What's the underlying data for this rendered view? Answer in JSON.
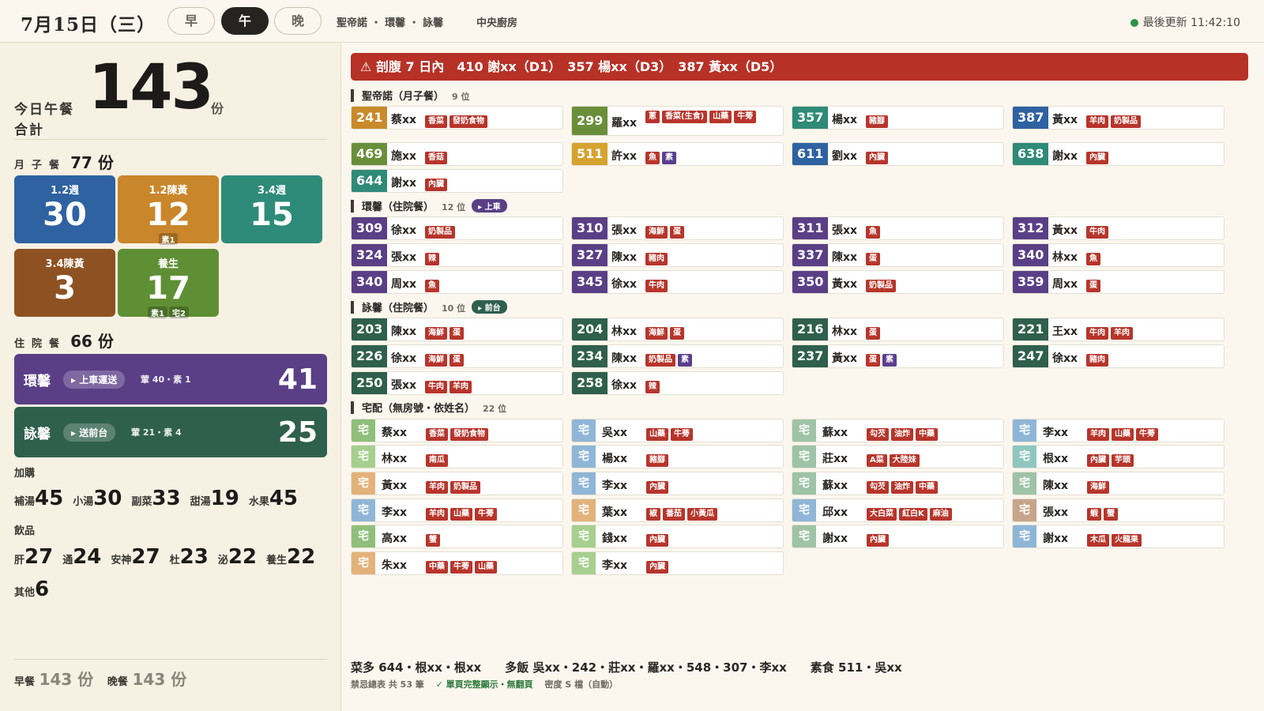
{
  "topbar": {
    "date": "7月15日（三）",
    "meals": [
      "早",
      "午",
      "晚"
    ],
    "active_meal": 1,
    "locations": [
      "聖帝諾",
      "環馨",
      "詠馨"
    ],
    "kitchen": "中央廚房",
    "update_label": "最後更新 11:42:10"
  },
  "sidebar": {
    "today_label": "今日午餐",
    "total_label": "合計",
    "total": "143",
    "unit": "份",
    "yuezi": {
      "label": "月子餐",
      "value": "77 份"
    },
    "tiles": [
      {
        "label": "1.2週",
        "value": "30",
        "badges": [],
        "color": "#2f62a1"
      },
      {
        "label": "1.2陳黃",
        "value": "12",
        "badges": [
          "素1"
        ],
        "color": "#c9862a"
      },
      {
        "label": "3.4週",
        "value": "15",
        "badges": [],
        "color": "#2e8b7a"
      },
      {
        "label": "3.4陳黃",
        "value": "3",
        "badges": [],
        "color": "#8e5222"
      },
      {
        "label": "養生",
        "value": "17",
        "badges": [
          "素1",
          "宅2"
        ],
        "color": "#5f8f34"
      }
    ],
    "hospital": {
      "label": "住院餐",
      "value": "66 份"
    },
    "wards": [
      {
        "name": "環馨",
        "tag": "▸ 上車運送",
        "sub": "葷 40・素 1",
        "value": "41",
        "color": "#5a3f86"
      },
      {
        "name": "詠馨",
        "tag": "▸ 送前台",
        "sub": "葷 21・素 4",
        "value": "25",
        "color": "#2f5f4d"
      }
    ],
    "addon_label": "加購",
    "addons": [
      {
        "k": "補湯",
        "v": "45"
      },
      {
        "k": "小湯",
        "v": "30"
      },
      {
        "k": "副菜",
        "v": "33"
      },
      {
        "k": "甜湯",
        "v": "19"
      },
      {
        "k": "水果",
        "v": "45"
      }
    ],
    "drinks_label": "飲品",
    "drinks": [
      {
        "k": "肝",
        "v": "27"
      },
      {
        "k": "通",
        "v": "24"
      },
      {
        "k": "安神",
        "v": "27"
      },
      {
        "k": "杜",
        "v": "23"
      },
      {
        "k": "泌",
        "v": "22"
      },
      {
        "k": "養生",
        "v": "22"
      }
    ],
    "other": {
      "k": "其他",
      "v": "6"
    },
    "breakfast": {
      "k": "早餐",
      "v": "143 份"
    },
    "dinner": {
      "k": "晚餐",
      "v": "143 份"
    }
  },
  "alert": "⚠ 剖腹 7 日內　410 謝xx（D1）　357 楊xx（D3）　387 黃xx（D5）",
  "groups": [
    {
      "title": "聖帝諾（月子餐）",
      "count": "9 位",
      "tag": "",
      "tag_color": "",
      "rows": [
        [
          {
            "room": "241",
            "name": "蔡xx",
            "tags": [
              "香菜",
              "發奶食物"
            ],
            "color": "#c98a2b"
          },
          {
            "room": "299",
            "name": "羅xx",
            "tags": [
              "蔥",
              "香菜(生食)",
              "山藥",
              "牛蒡"
            ],
            "color": "#6a8f3a"
          },
          {
            "room": "357",
            "name": "楊xx",
            "tags": [
              "豬腳"
            ],
            "color": "#2f8a78"
          },
          {
            "room": "387",
            "name": "黃xx",
            "tags": [
              "羊肉",
              "奶製品"
            ],
            "color": "#2f62a1"
          }
        ],
        [
          {
            "room": "469",
            "name": "施xx",
            "tags": [
              "香菇"
            ],
            "color": "#6a8f3a"
          },
          {
            "room": "511",
            "name": "許xx",
            "tags": [
              "魚",
              "素"
            ],
            "color": "#d6a32e"
          },
          {
            "room": "611",
            "name": "劉xx",
            "tags": [
              "內臟"
            ],
            "color": "#2f62a1"
          },
          {
            "room": "638",
            "name": "謝xx",
            "tags": [
              "內臟"
            ],
            "color": "#2f8a78"
          }
        ],
        [
          {
            "room": "644",
            "name": "謝xx",
            "tags": [
              "內臟"
            ],
            "color": "#2f8a78"
          }
        ]
      ]
    },
    {
      "title": "環馨（住院餐）",
      "count": "12 位",
      "tag": "▸ 上車",
      "tag_color": "#5a3f86",
      "rows": [
        [
          {
            "room": "309",
            "name": "徐xx",
            "tags": [
              "奶製品"
            ],
            "color": "#5a3f86"
          },
          {
            "room": "310",
            "name": "張xx",
            "tags": [
              "海鮮",
              "蛋"
            ],
            "color": "#5a3f86"
          },
          {
            "room": "311",
            "name": "張xx",
            "tags": [
              "魚"
            ],
            "color": "#5a3f86"
          },
          {
            "room": "312",
            "name": "黃xx",
            "tags": [
              "牛肉"
            ],
            "color": "#5a3f86"
          }
        ],
        [
          {
            "room": "324",
            "name": "張xx",
            "tags": [
              "辣"
            ],
            "color": "#5a3f86"
          },
          {
            "room": "327",
            "name": "陳xx",
            "tags": [
              "豬肉"
            ],
            "color": "#5a3f86"
          },
          {
            "room": "337",
            "name": "陳xx",
            "tags": [
              "蛋"
            ],
            "color": "#5a3f86"
          },
          {
            "room": "340",
            "name": "林xx",
            "tags": [
              "魚"
            ],
            "color": "#5a3f86"
          }
        ],
        [
          {
            "room": "340",
            "name": "周xx",
            "tags": [
              "魚"
            ],
            "color": "#5a3f86"
          },
          {
            "room": "345",
            "name": "徐xx",
            "tags": [
              "牛肉"
            ],
            "color": "#5a3f86"
          },
          {
            "room": "350",
            "name": "黃xx",
            "tags": [
              "奶製品"
            ],
            "color": "#5a3f86"
          },
          {
            "room": "359",
            "name": "周xx",
            "tags": [
              "蛋"
            ],
            "color": "#5a3f86"
          }
        ]
      ]
    },
    {
      "title": "詠馨（住院餐）",
      "count": "10 位",
      "tag": "▸ 前台",
      "tag_color": "#2f5f4d",
      "rows": [
        [
          {
            "room": "203",
            "name": "陳xx",
            "tags": [
              "海鮮",
              "蛋"
            ],
            "color": "#2f5f4d"
          },
          {
            "room": "204",
            "name": "林xx",
            "tags": [
              "海鮮",
              "蛋"
            ],
            "color": "#2f5f4d"
          },
          {
            "room": "216",
            "name": "林xx",
            "tags": [
              "蛋"
            ],
            "color": "#2f5f4d"
          },
          {
            "room": "221",
            "name": "王xx",
            "tags": [
              "牛肉",
              "羊肉"
            ],
            "color": "#2f5f4d"
          }
        ],
        [
          {
            "room": "226",
            "name": "徐xx",
            "tags": [
              "海鮮",
              "蛋"
            ],
            "color": "#2f5f4d"
          },
          {
            "room": "234",
            "name": "陳xx",
            "tags": [
              "奶製品",
              "素"
            ],
            "color": "#2f5f4d"
          },
          {
            "room": "237",
            "name": "黃xx",
            "tags": [
              "蛋",
              "素"
            ],
            "color": "#2f5f4d"
          },
          {
            "room": "247",
            "name": "徐xx",
            "tags": [
              "豬肉"
            ],
            "color": "#2f5f4d"
          }
        ],
        [
          {
            "room": "250",
            "name": "張xx",
            "tags": [
              "牛肉",
              "羊肉"
            ],
            "color": "#2f5f4d"
          },
          {
            "room": "258",
            "name": "徐xx",
            "tags": [
              "辣"
            ],
            "color": "#2f5f4d"
          }
        ]
      ]
    },
    {
      "title": "宅配（無房號・依姓名）",
      "count": "22 位",
      "tag": "",
      "tag_color": "",
      "rows": [
        [
          {
            "room": "宅",
            "name": "蔡xx",
            "tags": [
              "香菜",
              "發奶食物"
            ],
            "color": "#8fbf7a"
          },
          {
            "room": "宅",
            "name": "吳xx",
            "tags": [
              "山藥",
              "牛蒡"
            ],
            "color": "#8fb6d6"
          },
          {
            "room": "宅",
            "name": "蘇xx",
            "tags": [
              "勾芡",
              "油炸",
              "中藥"
            ],
            "color": "#9fc3a6"
          },
          {
            "room": "宅",
            "name": "李xx",
            "tags": [
              "羊肉",
              "山藥",
              "牛蒡"
            ],
            "color": "#8fb6d6"
          }
        ],
        [
          {
            "room": "宅",
            "name": "林xx",
            "tags": [
              "南瓜"
            ],
            "color": "#a7cf8e"
          },
          {
            "room": "宅",
            "name": "楊xx",
            "tags": [
              "豬腳"
            ],
            "color": "#8fb6d6"
          },
          {
            "room": "宅",
            "name": "莊xx",
            "tags": [
              "A菜",
              "大陸妹"
            ],
            "color": "#9fc3a6"
          },
          {
            "room": "宅",
            "name": "根xx",
            "tags": [
              "內臟",
              "芋頭"
            ],
            "color": "#8fc7c0"
          }
        ],
        [
          {
            "room": "宅",
            "name": "黃xx",
            "tags": [
              "羊肉",
              "奶製品"
            ],
            "color": "#e3b27a"
          },
          {
            "room": "宅",
            "name": "李xx",
            "tags": [
              "內臟"
            ],
            "color": "#8fb6d6"
          },
          {
            "room": "宅",
            "name": "蘇xx",
            "tags": [
              "勾芡",
              "油炸",
              "中藥"
            ],
            "color": "#9fc3a6"
          },
          {
            "room": "宅",
            "name": "陳xx",
            "tags": [
              "海鮮"
            ],
            "color": "#9fc3a6"
          }
        ],
        [
          {
            "room": "宅",
            "name": "李xx",
            "tags": [
              "羊肉",
              "山藥",
              "牛蒡"
            ],
            "color": "#8fb6d6"
          },
          {
            "room": "宅",
            "name": "葉xx",
            "tags": [
              "椒",
              "番茄",
              "小黃瓜"
            ],
            "color": "#e3b27a"
          },
          {
            "room": "宅",
            "name": "邱xx",
            "tags": [
              "大白菜",
              "紅白K",
              "麻油"
            ],
            "color": "#8fb6d6"
          },
          {
            "room": "宅",
            "name": "張xx",
            "tags": [
              "蝦",
              "蟹"
            ],
            "color": "#c7a58a"
          }
        ],
        [
          {
            "room": "宅",
            "name": "高xx",
            "tags": [
              "蟹"
            ],
            "color": "#8fbf7a"
          },
          {
            "room": "宅",
            "name": "錢xx",
            "tags": [
              "內臟"
            ],
            "color": "#a7cf8e"
          },
          {
            "room": "宅",
            "name": "謝xx",
            "tags": [
              "內臟"
            ],
            "color": "#9fc3a6"
          },
          {
            "room": "宅",
            "name": "謝xx",
            "tags": [
              "木瓜",
              "火龍果"
            ],
            "color": "#8fb6d6"
          }
        ],
        [
          {
            "room": "宅",
            "name": "朱xx",
            "tags": [
              "中藥",
              "牛蒡",
              "山藥"
            ],
            "color": "#e3b27a"
          },
          {
            "room": "宅",
            "name": "李xx",
            "tags": [
              "內臟"
            ],
            "color": "#a7cf8e"
          }
        ]
      ]
    }
  ],
  "footer": {
    "summary": "菜多 644・根xx・根xx　　多飯 吳xx・242・莊xx・羅xx・548・307・李xx　　素食 511・吳xx",
    "note_total": "禁忌總表 共 53 筆",
    "note_ok": "✓ 單頁完整顯示・無翻頁",
    "note_density": "密度 S 檔（自動）"
  }
}
